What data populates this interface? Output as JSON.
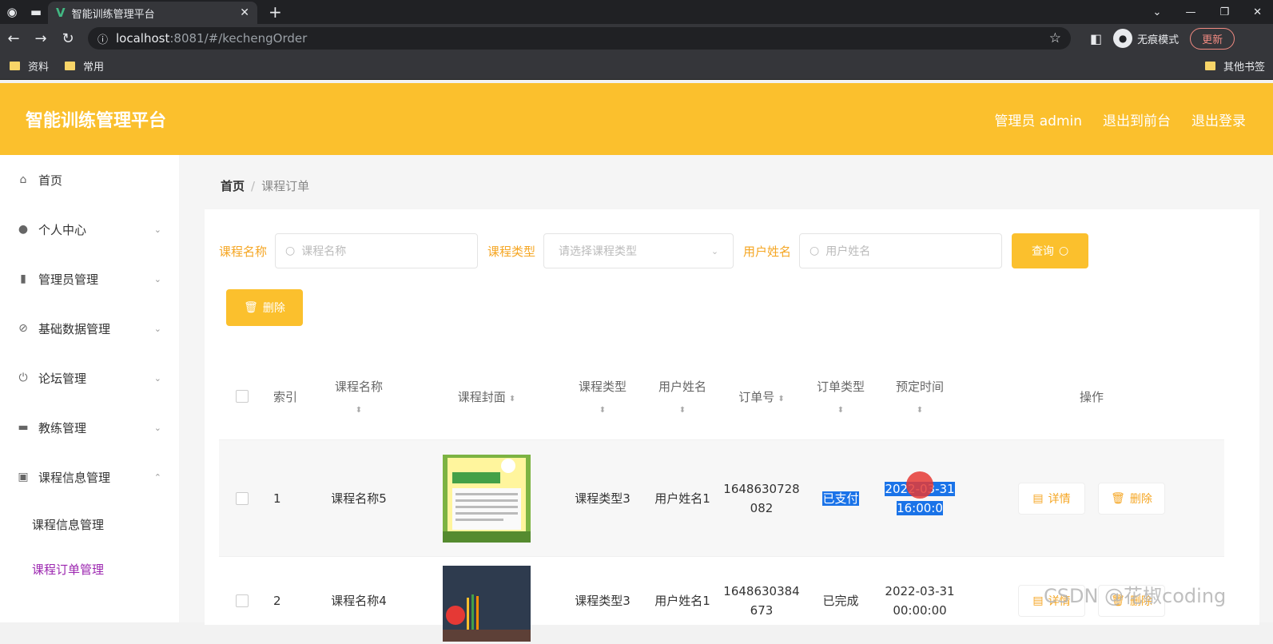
{
  "browser": {
    "tab_title": "智能训练管理平台",
    "url_host": "localhost",
    "url_path": ":8081/#/kechengOrder",
    "incognito_label": "无痕模式",
    "update_label": "更新",
    "bookmarks": [
      "资料",
      "常用"
    ],
    "other_bookmarks": "其他书签"
  },
  "header": {
    "title": "智能训练管理平台",
    "admin": "管理员 admin",
    "to_front": "退出到前台",
    "logout": "退出登录"
  },
  "sidebar": {
    "items": [
      {
        "label": "首页",
        "icon": "home-icon"
      },
      {
        "label": "个人中心",
        "icon": "user-icon"
      },
      {
        "label": "管理员管理",
        "icon": "chart-icon"
      },
      {
        "label": "基础数据管理",
        "icon": "bell-off-icon"
      },
      {
        "label": "论坛管理",
        "icon": "power-icon"
      },
      {
        "label": "教练管理",
        "icon": "chat-icon"
      },
      {
        "label": "课程信息管理",
        "icon": "clipboard-icon"
      }
    ],
    "sub_items": [
      "课程信息管理",
      "课程订单管理"
    ]
  },
  "breadcrumb": {
    "home": "首页",
    "current": "课程订单"
  },
  "search": {
    "course_name_label": "课程名称",
    "course_name_placeholder": "课程名称",
    "course_type_label": "课程类型",
    "course_type_placeholder": "请选择课程类型",
    "user_name_label": "用户姓名",
    "user_name_placeholder": "用户姓名",
    "query_button": "查询"
  },
  "delete_button": "删除",
  "table": {
    "headers": {
      "index": "索引",
      "course_name": "课程名称",
      "cover": "课程封面",
      "course_type": "课程类型",
      "user_name": "用户姓名",
      "order_no": "订单号",
      "order_type": "订单类型",
      "reserve_time": "预定时间",
      "ops": "操作"
    },
    "rows": [
      {
        "index": "1",
        "course_name": "课程名称5",
        "course_type": "课程类型3",
        "user_name": "用户姓名1",
        "order_no": "1648630728082",
        "order_type": "已支付",
        "reserve_time": "2022-03-31 16:00:0"
      },
      {
        "index": "2",
        "course_name": "课程名称4",
        "course_type": "课程类型3",
        "user_name": "用户姓名1",
        "order_no": "1648630384673",
        "order_type": "已完成",
        "reserve_time": "2022-03-31 00:00:00"
      }
    ],
    "detail_label": "详情",
    "delete_label": "删除"
  },
  "watermark": "CSDN @花椒coding",
  "colors": {
    "accent": "#fbc02d",
    "label": "#f5a623",
    "active_sub": "#9c27b0",
    "selection": "#1a73e8"
  }
}
